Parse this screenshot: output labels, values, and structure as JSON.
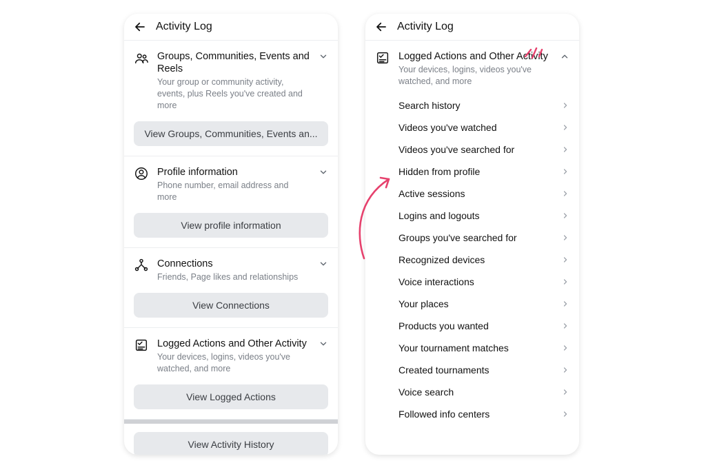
{
  "left": {
    "title": "Activity Log",
    "sections": [
      {
        "icon": "groups-icon",
        "title": "Groups, Communities, Events and Reels",
        "subtitle": "Your group or community activity, events, plus Reels you've created and more",
        "button": "View Groups, Communities, Events an..."
      },
      {
        "icon": "profile-icon",
        "title": "Profile information",
        "subtitle": "Phone number, email address and more",
        "button": "View profile information"
      },
      {
        "icon": "connections-icon",
        "title": "Connections",
        "subtitle": "Friends, Page likes and relationships",
        "button": "View Connections"
      },
      {
        "icon": "logged-actions-icon",
        "title": "Logged Actions and Other Activity",
        "subtitle": "Your devices, logins, videos you've watched, and more",
        "button": "View Logged Actions"
      }
    ],
    "footer_button": "View Activity History"
  },
  "right": {
    "title": "Activity Log",
    "section": {
      "title": "Logged Actions and Other Activity",
      "subtitle": "Your devices, logins, videos you've watched, and more"
    },
    "items": [
      "Search history",
      "Videos you've watched",
      "Videos you've searched for",
      "Hidden from profile",
      "Active sessions",
      "Logins and logouts",
      "Groups you've searched for",
      "Recognized devices",
      "Voice interactions",
      "Your places",
      "Products you wanted",
      "Your tournament matches",
      "Created tournaments",
      "Voice search",
      "Followed info centers"
    ]
  },
  "annotation_color": "#e6416d"
}
